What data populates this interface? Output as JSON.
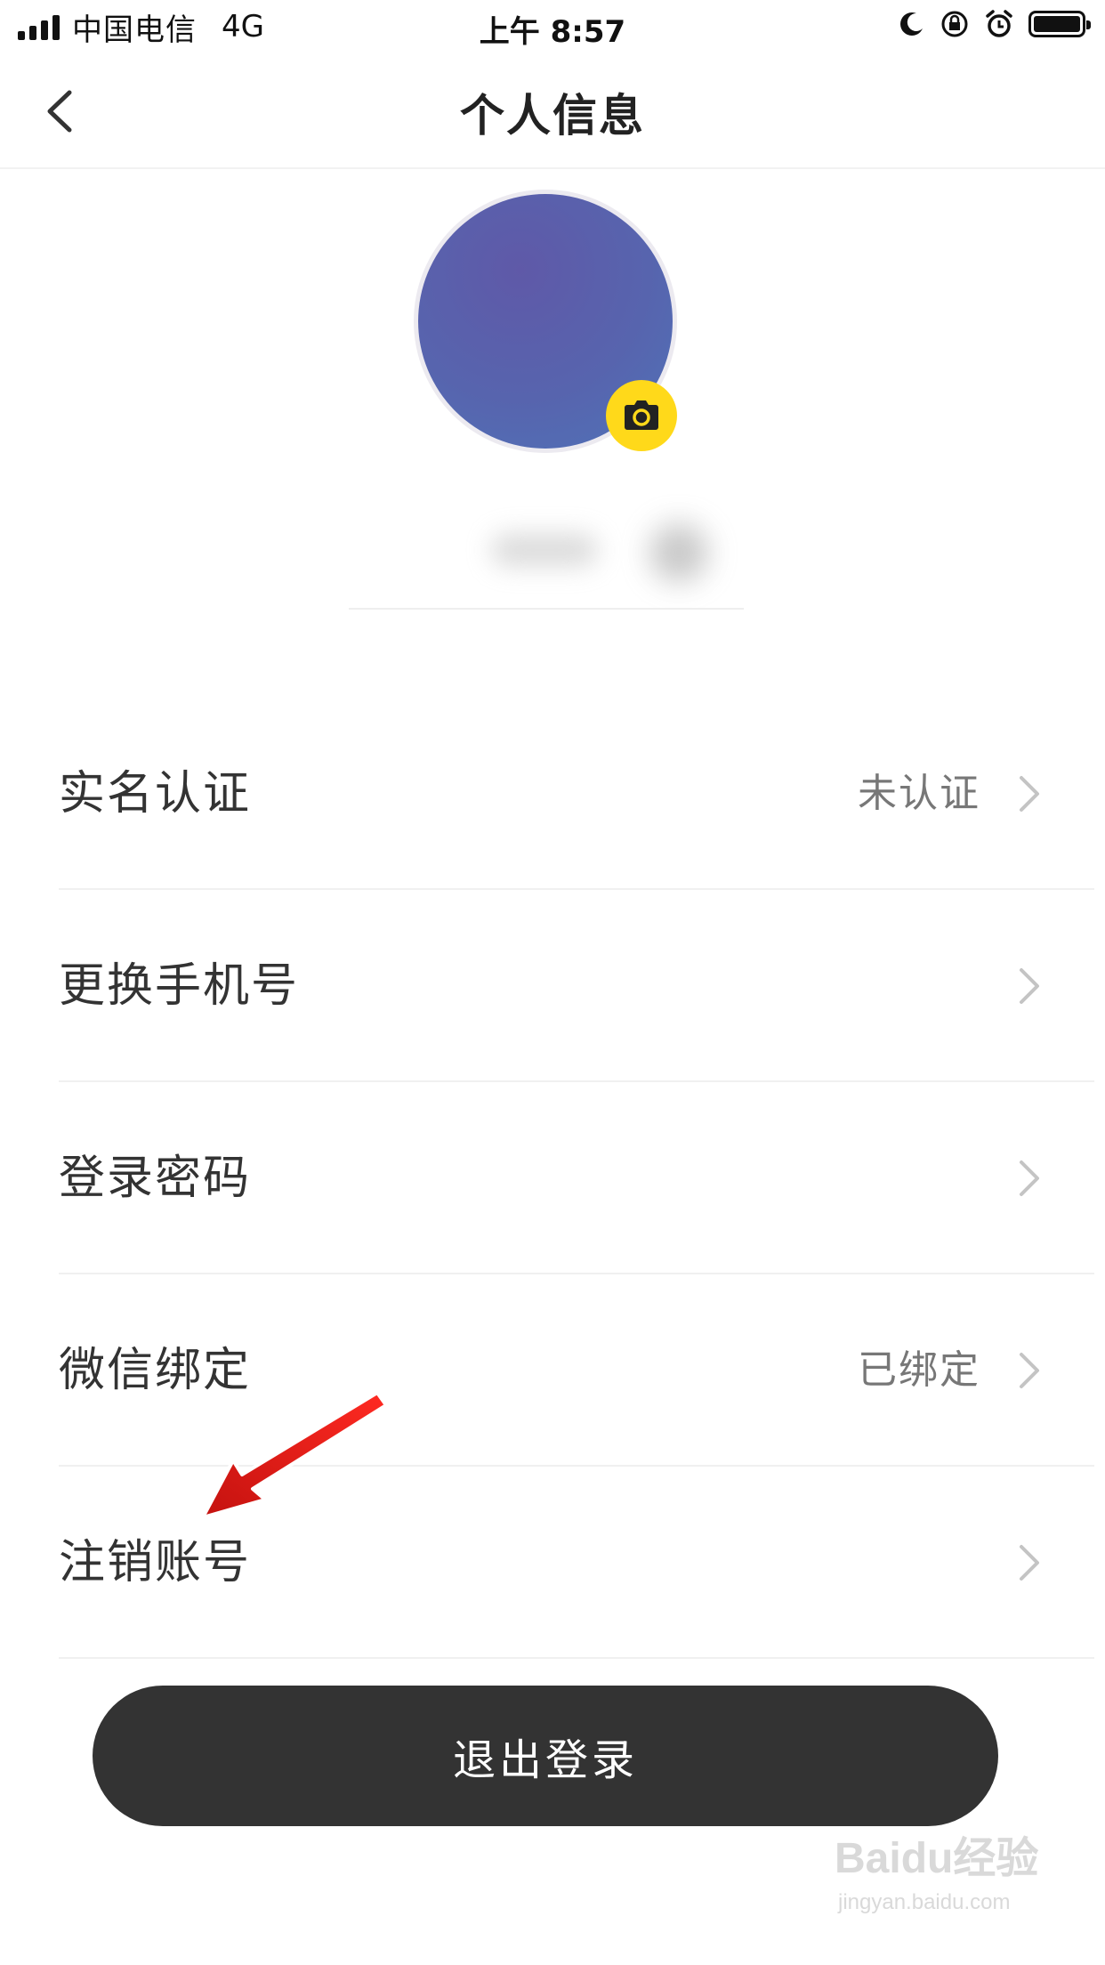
{
  "status_bar": {
    "carrier": "中国电信",
    "network": "4G",
    "time": "上午 8:57",
    "icons": [
      "moon-icon",
      "orientation-lock-icon",
      "alarm-icon",
      "battery-icon"
    ]
  },
  "nav": {
    "title": "个人信息",
    "back_icon": "chevron-left-icon"
  },
  "profile": {
    "avatar_colors": [
      "#5f59a8",
      "#4f73b8"
    ],
    "camera_icon": "camera-icon",
    "camera_color": "#ffd91a"
  },
  "settings": {
    "items": [
      {
        "label": "实名认证",
        "value": "未认证"
      },
      {
        "label": "更换手机号",
        "value": ""
      },
      {
        "label": "登录密码",
        "value": ""
      },
      {
        "label": "微信绑定",
        "value": "已绑定"
      },
      {
        "label": "注销账号",
        "value": ""
      }
    ]
  },
  "actions": {
    "logout_label": "退出登录",
    "logout_color": "#333333"
  },
  "annotation": {
    "arrow_color": "#e8211c",
    "points_to": "注销账号"
  },
  "watermark": {
    "brand": "Baidu经验",
    "url": "jingyan.baidu.com"
  }
}
